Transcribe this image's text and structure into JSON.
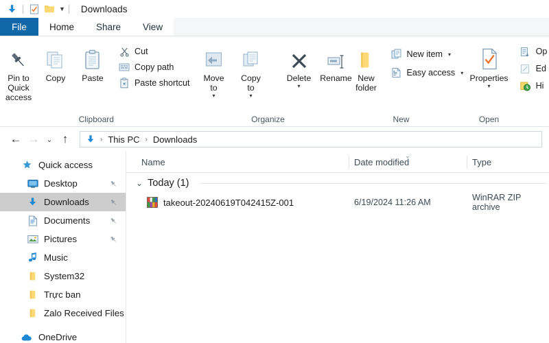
{
  "titlebar": {
    "title": "Downloads",
    "icons": [
      "download-arrow-icon",
      "properties-check-icon",
      "folder-icon",
      "customize-chevron-icon"
    ]
  },
  "tabs": [
    {
      "label": "File",
      "state": "file-menu"
    },
    {
      "label": "Home",
      "state": "active"
    },
    {
      "label": "Share",
      "state": "inactive"
    },
    {
      "label": "View",
      "state": "inactive"
    }
  ],
  "ribbon": {
    "groups": [
      {
        "name": "Clipboard",
        "label": "Clipboard",
        "big": [
          {
            "label": "Pin to Quick\naccess",
            "icon": "pin-icon"
          },
          {
            "label": "Copy",
            "icon": "copy-icon"
          },
          {
            "label": "Paste",
            "icon": "paste-icon"
          }
        ],
        "small": [
          {
            "label": "Cut",
            "icon": "scissors-icon"
          },
          {
            "label": "Copy path",
            "icon": "copy-path-icon"
          },
          {
            "label": "Paste shortcut",
            "icon": "paste-shortcut-icon"
          }
        ]
      },
      {
        "name": "Organize",
        "label": "Organize",
        "big": [
          {
            "label": "Move\nto",
            "icon": "move-to-icon",
            "caret": "▾"
          },
          {
            "label": "Copy\nto",
            "icon": "copy-to-icon",
            "caret": "▾"
          },
          {
            "label": "Delete",
            "icon": "delete-x-icon",
            "caret": "▾"
          },
          {
            "label": "Rename",
            "icon": "rename-icon"
          }
        ]
      },
      {
        "name": "New",
        "label": "New",
        "big": [
          {
            "label": "New\nfolder",
            "icon": "new-folder-icon"
          }
        ],
        "small": [
          {
            "label": "New item",
            "icon": "new-item-icon",
            "caret": "▾"
          },
          {
            "label": "Easy access",
            "icon": "easy-access-icon",
            "caret": "▾"
          }
        ]
      },
      {
        "name": "Open",
        "label": "Open",
        "big": [
          {
            "label": "Properties",
            "icon": "properties-icon",
            "caret": "▾"
          }
        ],
        "small": [
          {
            "label": "Op",
            "icon": "open-icon"
          },
          {
            "label": "Ed",
            "icon": "edit-icon"
          },
          {
            "label": "Hi",
            "icon": "history-icon"
          }
        ]
      }
    ]
  },
  "addressbar": {
    "back": "←",
    "forward": "→",
    "recent": "⌄",
    "up": "↑",
    "icon": "download-arrow-icon",
    "breadcrumbs": [
      "This PC",
      "Downloads"
    ],
    "separator": "›"
  },
  "sidebar": {
    "items": [
      {
        "label": "Quick access",
        "icon": "star-icon",
        "level": "root",
        "pinned": false,
        "selected": false
      },
      {
        "label": "Desktop",
        "icon": "desktop-icon",
        "level": "child",
        "pinned": true,
        "selected": false
      },
      {
        "label": "Downloads",
        "icon": "download-arrow-icon",
        "level": "child",
        "pinned": true,
        "selected": true
      },
      {
        "label": "Documents",
        "icon": "documents-icon",
        "level": "child",
        "pinned": true,
        "selected": false
      },
      {
        "label": "Pictures",
        "icon": "pictures-icon",
        "level": "child",
        "pinned": true,
        "selected": false
      },
      {
        "label": "Music",
        "icon": "music-note-icon",
        "level": "child",
        "pinned": false,
        "selected": false
      },
      {
        "label": "System32",
        "icon": "folder-icon",
        "level": "child",
        "pinned": false,
        "selected": false
      },
      {
        "label": "Trực ban",
        "icon": "folder-icon",
        "level": "child",
        "pinned": false,
        "selected": false
      },
      {
        "label": "Zalo Received Files",
        "icon": "folder-icon",
        "level": "child",
        "pinned": false,
        "selected": false
      },
      {
        "label": "OneDrive",
        "icon": "cloud-icon",
        "level": "root",
        "pinned": false,
        "selected": false
      }
    ]
  },
  "filelist": {
    "columns": [
      {
        "label": "Name",
        "sorted": false
      },
      {
        "label": "Date modified",
        "sorted": true,
        "sort_indicator": "⌄"
      },
      {
        "label": "Type",
        "sorted": false
      }
    ],
    "group": {
      "chevron": "⌄",
      "label": "Today (1)"
    },
    "rows": [
      {
        "name": "takeout-20240619T042415Z-001",
        "date_modified": "6/19/2024 11:26 AM",
        "type": "WinRAR ZIP archive",
        "icon": "winrar-archive-icon"
      }
    ]
  },
  "colors": {
    "file_tab_blue": "#1167a8",
    "accent_blue": "#1e8ad6",
    "selection_gray": "#cdcdcd",
    "folder_yellow": "#fcd975",
    "properties_orange": "#e8762c"
  }
}
